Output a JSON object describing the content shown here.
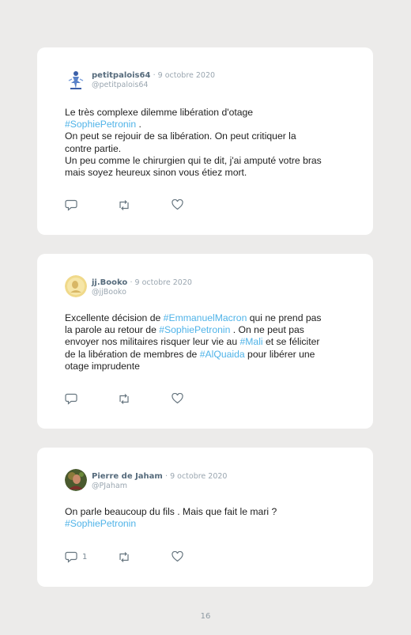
{
  "tweets": [
    {
      "name": "petitpalois64",
      "date": "· 9 octobre 2020",
      "handle": "@petitpalois64",
      "reply_count": "",
      "lines": [
        [
          {
            "t": "Le très complexe dilemme libération d'otage"
          }
        ],
        [
          {
            "t": "#SophiePetronin",
            "tag": true
          },
          {
            "t": " ."
          }
        ],
        [
          {
            "t": "On peut se rejouir de sa libération. On peut critiquer la"
          }
        ],
        [
          {
            "t": "contre partie."
          }
        ],
        [
          {
            "t": "Un peu comme le chirurgien qui te dit, j'ai amputé votre bras"
          }
        ],
        [
          {
            "t": "mais soyez heureux sinon vous étiez mort."
          }
        ]
      ]
    },
    {
      "name": "jj.Booko",
      "date": "· 9 octobre 2020",
      "handle": "@jjBooko",
      "reply_count": "",
      "lines": [
        [
          {
            "t": "Excellente décision de "
          },
          {
            "t": "#EmmanuelMacron",
            "tag": true
          },
          {
            "t": " qui ne prend pas"
          }
        ],
        [
          {
            "t": "la parole au retour de "
          },
          {
            "t": "#SophiePetronin",
            "tag": true
          },
          {
            "t": " . On ne peut pas"
          }
        ],
        [
          {
            "t": "envoyer nos militaires risquer leur vie au "
          },
          {
            "t": "#Mali",
            "tag": true
          },
          {
            "t": " et se féliciter"
          }
        ],
        [
          {
            "t": "de la libération de membres de "
          },
          {
            "t": "#AlQuaida",
            "tag": true
          },
          {
            "t": " pour libérer une"
          }
        ],
        [
          {
            "t": "otage imprudente"
          }
        ]
      ]
    },
    {
      "name": "Pierre de Jaham",
      "date": "· 9 octobre 2020",
      "handle": "@PJaham",
      "reply_count": "1",
      "lines": [
        [
          {
            "t": "On parle beaucoup du fils . Mais que fait le mari ?"
          }
        ],
        [
          {
            "t": "#SophiePetronin",
            "tag": true
          }
        ]
      ]
    }
  ],
  "page_number": "16"
}
